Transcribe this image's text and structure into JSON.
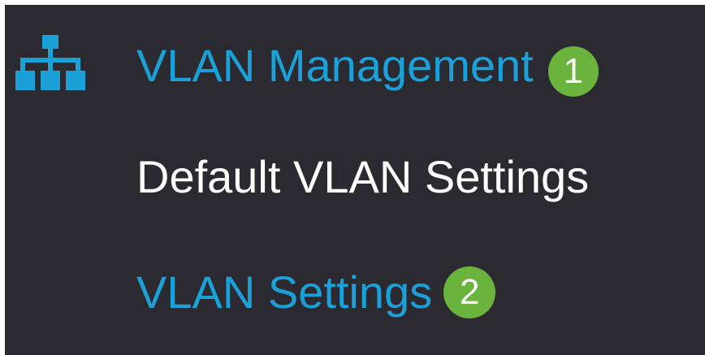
{
  "sidebar": {
    "section": {
      "label": "VLAN Management",
      "icon": "network-topology-icon",
      "color": "#1ba0d7",
      "step_badge": "1"
    },
    "items": [
      {
        "label": "Default VLAN Settings",
        "color": "#ffffff"
      },
      {
        "label": "VLAN Settings",
        "color": "#1ba0d7",
        "step_badge": "2"
      }
    ]
  },
  "colors": {
    "background": "#2b2a30",
    "accent": "#1ba0d7",
    "badge": "#6ab43e"
  }
}
